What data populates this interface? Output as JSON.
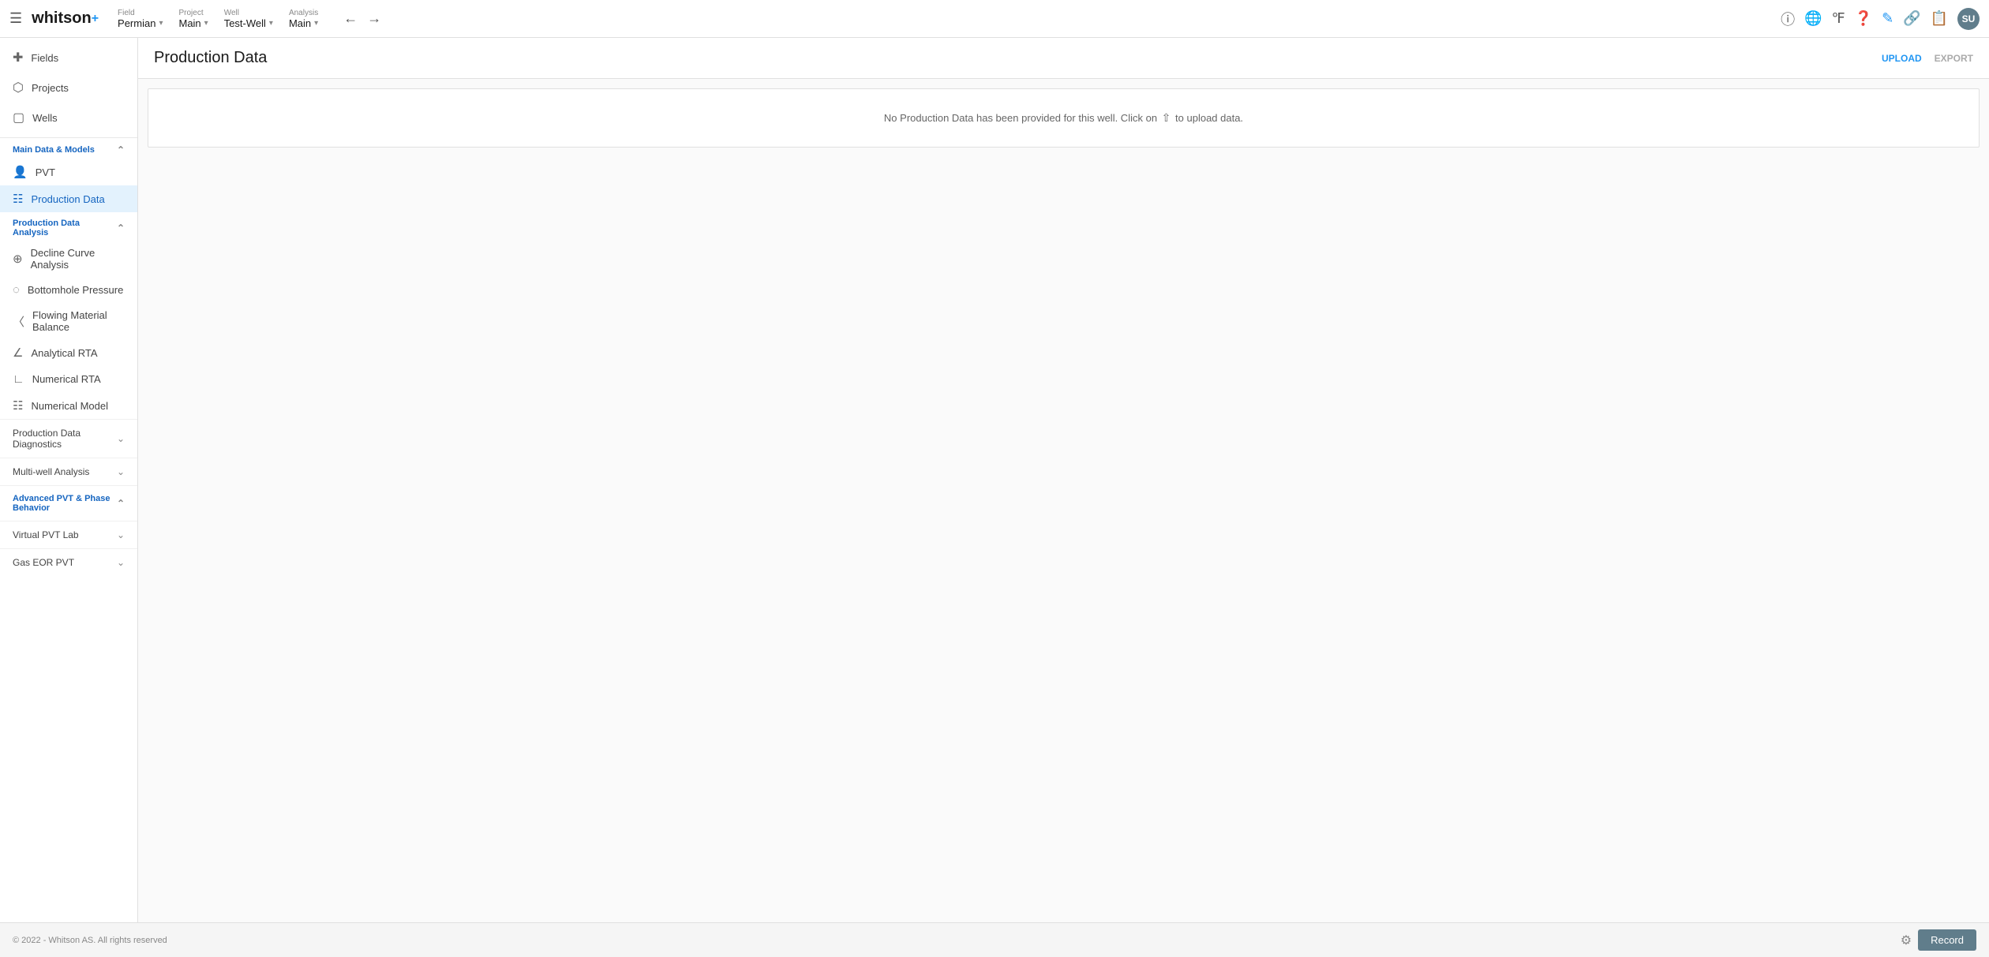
{
  "app": {
    "name": "whitson",
    "plus_sign": "+"
  },
  "topbar": {
    "field_label": "Field",
    "field_value": "Permian",
    "project_label": "Project",
    "project_value": "Main",
    "well_label": "Well",
    "well_value": "Test-Well",
    "analysis_label": "Analysis",
    "analysis_value": "Main"
  },
  "leftnav": {
    "top_items": [
      {
        "label": "Fields",
        "icon": "⊞"
      },
      {
        "label": "Projects",
        "icon": "⬡"
      },
      {
        "label": "Wells",
        "icon": "⊞"
      }
    ],
    "main_section_label": "Main Data & Models",
    "main_section_items": [
      {
        "label": "PVT",
        "icon": "👤",
        "active": false
      },
      {
        "label": "Production Data",
        "icon": "📈",
        "active": true
      }
    ],
    "analysis_section_label": "Production Data Analysis",
    "analysis_section_items": [
      {
        "label": "Decline Curve Analysis",
        "icon": "⊕"
      },
      {
        "label": "Bottomhole Pressure",
        "icon": "🕐"
      },
      {
        "label": "Flowing Material Balance",
        "icon": "📊"
      },
      {
        "label": "Analytical RTA",
        "icon": "📉"
      },
      {
        "label": "Numerical RTA",
        "icon": "⊾"
      },
      {
        "label": "Numerical Model",
        "icon": "▦"
      }
    ],
    "collapsed_sections": [
      {
        "label": "Production Data Diagnostics"
      },
      {
        "label": "Multi-well Analysis"
      },
      {
        "label": "Advanced PVT & Phase Behavior"
      },
      {
        "label": "Virtual PVT Lab"
      },
      {
        "label": "Gas EOR PVT"
      }
    ]
  },
  "page": {
    "title": "Production Data",
    "upload_label": "UPLOAD",
    "export_label": "EXPORT",
    "empty_message_before": "No Production Data has been provided for this well. Click on",
    "empty_message_after": "to upload data."
  },
  "footer": {
    "copyright": "© 2022 - Whitson AS. All rights reserved",
    "record_btn": "Record"
  },
  "avatar_initials": "SU"
}
